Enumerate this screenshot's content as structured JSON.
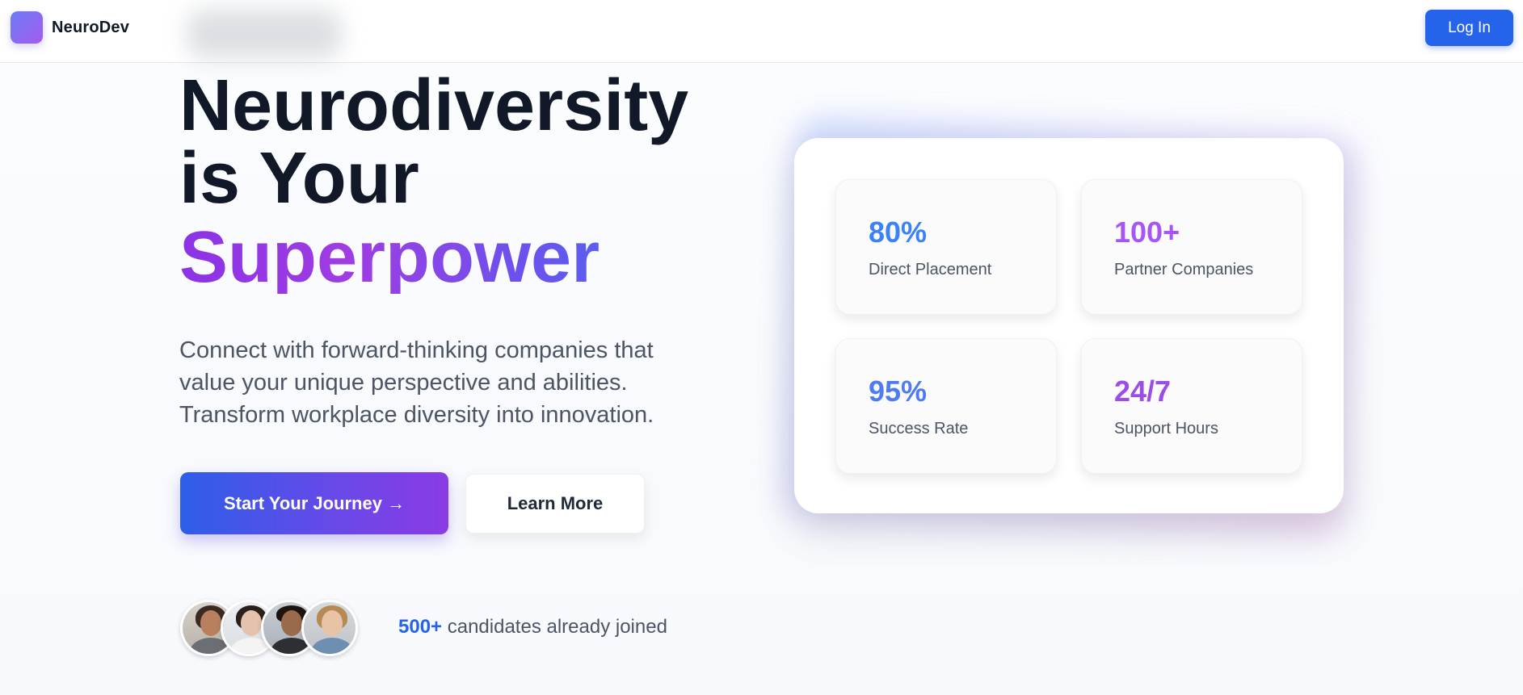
{
  "header": {
    "brand_name": "NeuroDev",
    "login_label": "Log In"
  },
  "hero": {
    "headline_line1": "Neurodiversity",
    "headline_line2": "is Your",
    "headline_accent": "Superpower",
    "subtext": "Connect with forward-thinking companies that value your unique perspective and abilities. Transform workplace diversity into innovation.",
    "primary_cta": "Start Your Journey →",
    "secondary_cta": "Learn More"
  },
  "social_proof": {
    "count": "500+",
    "text": " candidates already joined"
  },
  "stats": [
    {
      "value": "80%",
      "label": "Direct Placement",
      "color": "#3b82f6"
    },
    {
      "value": "100+",
      "label": "Partner Companies",
      "color": "#a855f7"
    },
    {
      "value": "95%",
      "label": "Success Rate",
      "color": "#4f7bf0"
    },
    {
      "value": "24/7",
      "label": "Support Hours",
      "color": "#9b4de8"
    }
  ],
  "colors": {
    "brand_blue": "#2563eb",
    "accent_purple": "#9333ea"
  }
}
